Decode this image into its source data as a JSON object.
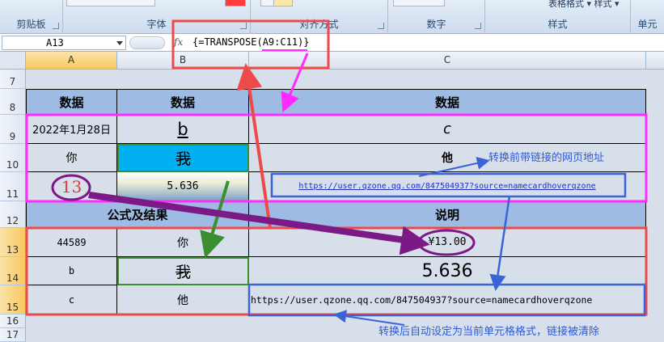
{
  "ribbon": {
    "groups": [
      {
        "label": "剪贴板"
      },
      {
        "label": "字体"
      },
      {
        "label": "对齐方式"
      },
      {
        "label": "数字"
      },
      {
        "label": "样式"
      },
      {
        "label": "单元"
      }
    ],
    "style_buttons": {
      "table_format": "表格格式",
      "cell_style": "样式"
    }
  },
  "formula_bar": {
    "name_box": "A13",
    "fx": "fx",
    "formula": "{=TRANSPOSE(A9:C11)}"
  },
  "columns": [
    "A",
    "B",
    "C"
  ],
  "rows": [
    "7",
    "8",
    "9",
    "10",
    "11",
    "12",
    "13",
    "14",
    "15",
    "16",
    "17"
  ],
  "table_top": {
    "headers": [
      "数据",
      "数据",
      "数据"
    ],
    "r9": [
      "2022年1月28日",
      "b",
      "c"
    ],
    "r10": [
      "你",
      "我",
      "他"
    ],
    "r11": [
      "13",
      "5.636",
      "https://user.qzone.qq.com/847504937?source=namecardhoverqzone"
    ]
  },
  "table_bottom": {
    "headers": {
      "left": "公式及结果",
      "right": "说明"
    },
    "r13": [
      "44589",
      "你",
      "¥13.00"
    ],
    "r14": [
      "b",
      "我",
      "5.636"
    ],
    "r15": [
      "c",
      "他",
      "https://user.qzone.qq.com/847504937?source=namecardhoverqzone"
    ]
  },
  "annotations": {
    "top": "转换前带链接的网页地址",
    "bottom": "转换后自动设定为当前单元格格式，链接被清除"
  },
  "colors": {
    "header_fill": "#9dbbe3",
    "highlight_fill": "#00b0f0",
    "red": "#ef4a4a",
    "magenta": "#ff2bff",
    "purple": "#7b1a86",
    "green": "#3a8f2e",
    "blue": "#3a64d6"
  }
}
